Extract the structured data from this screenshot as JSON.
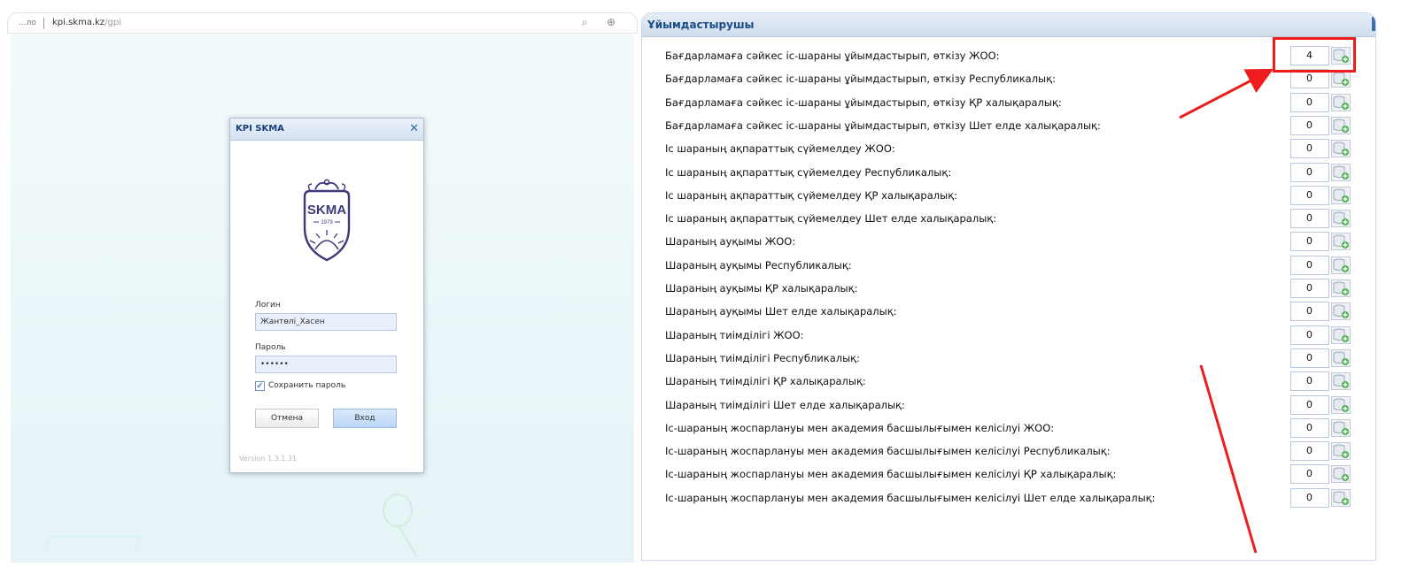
{
  "left": {
    "browser": {
      "address_prefix": "...ло",
      "url_host": "kpi.skma.kz",
      "url_path": "/gpi"
    },
    "dialog": {
      "title": "KPI SKMA",
      "logo_text": "SKMA",
      "logo_year": "1979",
      "login_label": "Логин",
      "login_value": "Жантөлі_Хасен",
      "password_label": "Пароль",
      "password_value": "••••••",
      "remember_label": "Сохранить пароль",
      "remember_checked": true,
      "cancel_label": "Отмена",
      "login_button": "Вход",
      "version": "Version 1.3.1.31"
    }
  },
  "right": {
    "panel_title": "Ұйымдастырушы",
    "rows": [
      {
        "label": "Бағдарламаға сәйкес іс-шараны ұйымдастырып, өткізу ЖОО:",
        "value": "4"
      },
      {
        "label": "Бағдарламаға сәйкес іс-шараны ұйымдастырып, өткізу Республикалық:",
        "value": "0"
      },
      {
        "label": "Бағдарламаға сәйкес іс-шараны ұйымдастырып, өткізу ҚР халықаралық:",
        "value": "0"
      },
      {
        "label": "Бағдарламаға сәйкес іс-шараны ұйымдастырып, өткізу Шет елде халықаралық:",
        "value": "0"
      },
      {
        "label": "Іс шараның ақпараттық сүйемелдеу ЖОО:",
        "value": "0"
      },
      {
        "label": "Іс шараның ақпараттық сүйемелдеу Республикалық:",
        "value": "0"
      },
      {
        "label": "Іс шараның ақпараттық сүйемелдеу ҚР халықаралық:",
        "value": "0"
      },
      {
        "label": "Іс шараның ақпараттық сүйемелдеу Шет елде халықаралық:",
        "value": "0"
      },
      {
        "label": "Шараның ауқымы ЖОО:",
        "value": "0"
      },
      {
        "label": "Шараның ауқымы Республикалық:",
        "value": "0"
      },
      {
        "label": "Шараның ауқымы ҚР халықаралық:",
        "value": "0"
      },
      {
        "label": "Шараның ауқымы Шет елде халықаралық:",
        "value": "0"
      },
      {
        "label": "Шараның тиімділігі ЖОО:",
        "value": "0"
      },
      {
        "label": "Шараның тиімділігі Республикалық:",
        "value": "0"
      },
      {
        "label": "Шараның тиімділігі ҚР халықаралық:",
        "value": "0"
      },
      {
        "label": "Шараның тиімділігі Шет елде халықаралық:",
        "value": "0"
      },
      {
        "label": "Іс-шараның жоспарлануы мен академия басшылығымен келісілуі ЖОО:",
        "value": "0"
      },
      {
        "label": "Іс-шараның жоспарлануы мен академия басшылығымен келісілуі Республикалық:",
        "value": "0"
      },
      {
        "label": "Іс-шараның жоспарлануы мен академия басшылығымен келісілуі ҚР халықаралық:",
        "value": "0"
      },
      {
        "label": "Іс-шараның жоспарлануы мен академия басшылығымен келісілуі Шет елде халықаралық:",
        "value": "0"
      }
    ]
  },
  "colors": {
    "annotation_red": "#ee1c1c",
    "panel_title": "#1c4c86",
    "db_icon_green": "#4caf50"
  }
}
